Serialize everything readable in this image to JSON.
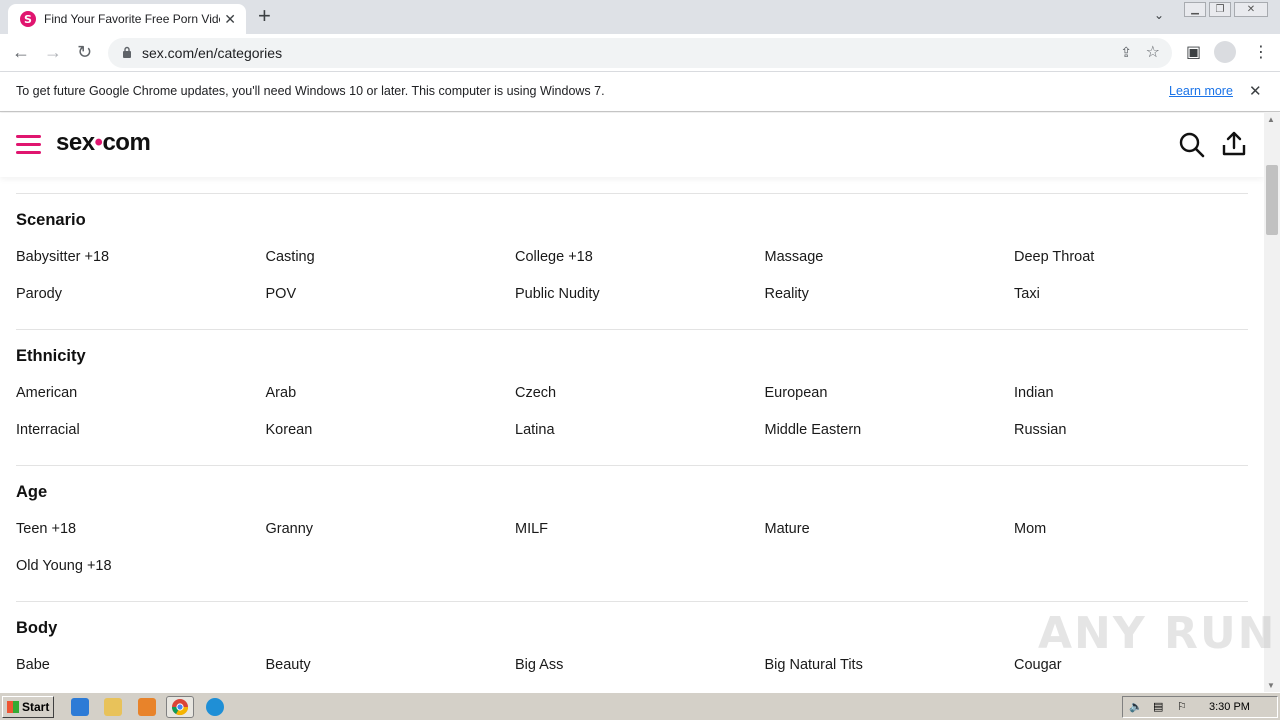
{
  "browser": {
    "tab_title": "Find Your Favorite Free Porn Videos",
    "tab_favicon_letter": "S",
    "new_tab_label": "+",
    "url": "sex.com/en/categories",
    "info_message": "To get future Google Chrome updates, you'll need Windows 10 or later. This computer is using Windows 7.",
    "info_link": "Learn more"
  },
  "site": {
    "logo_left": "sex",
    "logo_dot": "•",
    "logo_right": "com",
    "accent_color": "#e0156f"
  },
  "sections": [
    {
      "title": "Scenario",
      "items": [
        "Babysitter +18",
        "Casting",
        "College +18",
        "Massage",
        "Deep Throat",
        "Parody",
        "POV",
        "Public Nudity",
        "Reality",
        "Taxi"
      ]
    },
    {
      "title": "Ethnicity",
      "items": [
        "American",
        "Arab",
        "Czech",
        "European",
        "Indian",
        "Interracial",
        "Korean",
        "Latina",
        "Middle Eastern",
        "Russian"
      ]
    },
    {
      "title": "Age",
      "items": [
        "Teen +18",
        "Granny",
        "MILF",
        "Mature",
        "Mom",
        "Old Young +18"
      ]
    },
    {
      "title": "Body",
      "items": [
        "Babe",
        "Beauty",
        "Big Ass",
        "Big Natural Tits",
        "Cougar"
      ]
    }
  ],
  "watermark": "ANY RUN",
  "taskbar": {
    "start_label": "Start",
    "clock": "3:30 PM"
  }
}
